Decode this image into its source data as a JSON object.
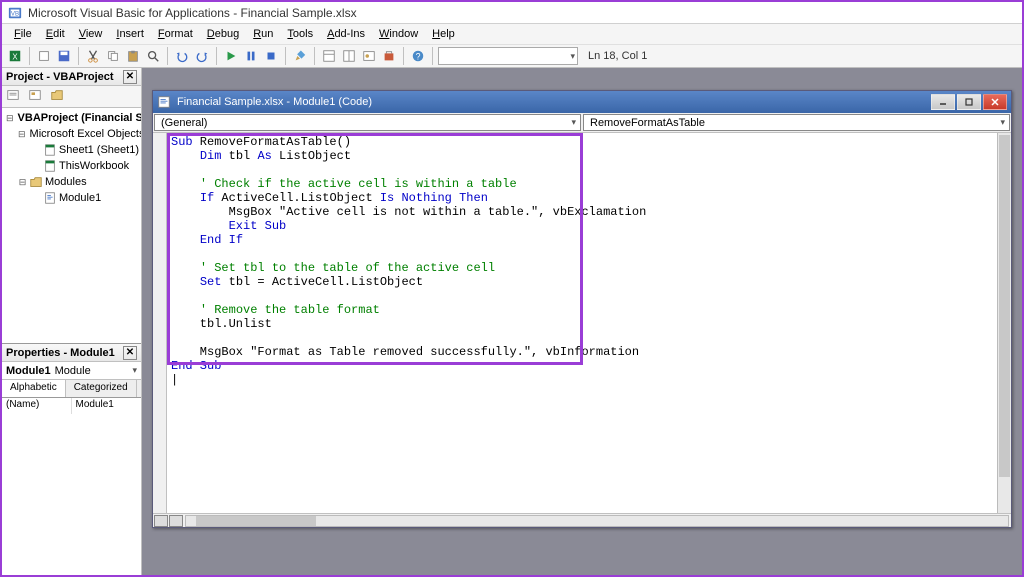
{
  "app": {
    "title": "Microsoft Visual Basic for Applications - Financial Sample.xlsx"
  },
  "menus": [
    "File",
    "Edit",
    "View",
    "Insert",
    "Format",
    "Debug",
    "Run",
    "Tools",
    "Add-Ins",
    "Window",
    "Help"
  ],
  "toolbar": {
    "status": "Ln 18, Col 1"
  },
  "project_pane": {
    "title": "Project - VBAProject",
    "tree": {
      "root": "VBAProject (Financial Sample.xlsx)",
      "excel_objects": "Microsoft Excel Objects",
      "sheet1": "Sheet1 (Sheet1)",
      "thisworkbook": "ThisWorkbook",
      "modules": "Modules",
      "module1": "Module1"
    }
  },
  "properties_pane": {
    "title": "Properties - Module1",
    "object_name": "Module1",
    "object_type": "Module",
    "tabs": {
      "alphabetic": "Alphabetic",
      "categorized": "Categorized"
    },
    "rows": [
      {
        "k": "(Name)",
        "v": "Module1"
      }
    ]
  },
  "code_window": {
    "title": "Financial Sample.xlsx - Module1 (Code)",
    "dd_left": "(General)",
    "dd_right": "RemoveFormatAsTable",
    "code_lines": [
      {
        "t": "Sub RemoveFormatAsTable()",
        "spans": [
          [
            "kw",
            "Sub"
          ],
          [
            "",
            " RemoveFormatAsTable()"
          ]
        ]
      },
      {
        "t": "    Dim tbl As ListObject",
        "spans": [
          [
            "",
            "    "
          ],
          [
            "kw",
            "Dim"
          ],
          [
            "",
            " tbl "
          ],
          [
            "kw",
            "As"
          ],
          [
            "",
            " ListObject"
          ]
        ]
      },
      {
        "t": ""
      },
      {
        "t": "    ' Check if the active cell is within a table",
        "spans": [
          [
            "",
            "    "
          ],
          [
            "cm",
            "' Check if the active cell is within a table"
          ]
        ]
      },
      {
        "t": "    If ActiveCell.ListObject Is Nothing Then",
        "spans": [
          [
            "",
            "    "
          ],
          [
            "kw",
            "If"
          ],
          [
            "",
            " ActiveCell.ListObject "
          ],
          [
            "kw",
            "Is"
          ],
          [
            "",
            " "
          ],
          [
            "kw",
            "Nothing"
          ],
          [
            "",
            " "
          ],
          [
            "kw",
            "Then"
          ]
        ]
      },
      {
        "t": "        MsgBox \"Active cell is not within a table.\", vbExclamation",
        "spans": [
          [
            "",
            "        MsgBox \"Active cell is not within a table.\", vbExclamation"
          ]
        ]
      },
      {
        "t": "        Exit Sub",
        "spans": [
          [
            "",
            "        "
          ],
          [
            "kw",
            "Exit Sub"
          ]
        ]
      },
      {
        "t": "    End If",
        "spans": [
          [
            "",
            "    "
          ],
          [
            "kw",
            "End If"
          ]
        ]
      },
      {
        "t": ""
      },
      {
        "t": "    ' Set tbl to the table of the active cell",
        "spans": [
          [
            "",
            "    "
          ],
          [
            "cm",
            "' Set tbl to the table of the active cell"
          ]
        ]
      },
      {
        "t": "    Set tbl = ActiveCell.ListObject",
        "spans": [
          [
            "",
            "    "
          ],
          [
            "kw",
            "Set"
          ],
          [
            "",
            " tbl = ActiveCell.ListObject"
          ]
        ]
      },
      {
        "t": ""
      },
      {
        "t": "    ' Remove the table format",
        "spans": [
          [
            "",
            "    "
          ],
          [
            "cm",
            "' Remove the table format"
          ]
        ]
      },
      {
        "t": "    tbl.Unlist",
        "spans": [
          [
            "",
            "    tbl.Unlist"
          ]
        ]
      },
      {
        "t": ""
      },
      {
        "t": "    MsgBox \"Format as Table removed successfully.\", vbInformation",
        "spans": [
          [
            "",
            "    MsgBox \"Format as Table removed successfully.\", vbInformation"
          ]
        ]
      },
      {
        "t": "End Sub",
        "spans": [
          [
            "kw",
            "End Sub"
          ]
        ]
      }
    ]
  }
}
